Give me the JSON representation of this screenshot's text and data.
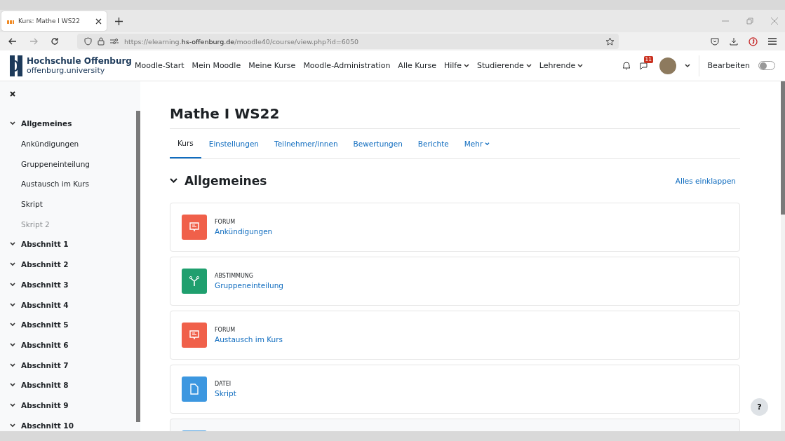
{
  "browser": {
    "tab": {
      "title": "Kurs: Mathe I WS22",
      "selected": true
    },
    "url": {
      "prefix": "https://elearning.",
      "host": "hs-offenburg.de",
      "path": "/moodle40/course/view.php?id=6050"
    }
  },
  "header": {
    "logo": {
      "name": "Hochschule Offenburg",
      "sub": "offenburg.university"
    },
    "nav": [
      {
        "label": "Moodle-Start",
        "dropdown": false
      },
      {
        "label": "Mein Moodle",
        "dropdown": false
      },
      {
        "label": "Meine Kurse",
        "dropdown": false
      },
      {
        "label": "Moodle-Administration",
        "dropdown": false
      },
      {
        "label": "Alle Kurse",
        "dropdown": false
      },
      {
        "label": "Hilfe",
        "dropdown": true
      },
      {
        "label": "Studierende",
        "dropdown": true
      },
      {
        "label": "Lehrende",
        "dropdown": true
      }
    ],
    "message_count": "11",
    "edit_mode": {
      "label": "Bearbeiten",
      "on": false
    }
  },
  "sidebar": {
    "items": [
      {
        "label": "Allgemeines",
        "children": [
          {
            "label": "Ankündigungen",
            "hidden": false
          },
          {
            "label": "Gruppeneinteilung",
            "hidden": false
          },
          {
            "label": "Austausch im Kurs",
            "hidden": false
          },
          {
            "label": "Skript",
            "hidden": false
          },
          {
            "label": "Skript 2",
            "hidden": true
          }
        ]
      },
      {
        "label": "Abschnitt 1"
      },
      {
        "label": "Abschnitt 2"
      },
      {
        "label": "Abschnitt 3"
      },
      {
        "label": "Abschnitt 4"
      },
      {
        "label": "Abschnitt 5"
      },
      {
        "label": "Abschnitt 6"
      },
      {
        "label": "Abschnitt 7"
      },
      {
        "label": "Abschnitt 8"
      },
      {
        "label": "Abschnitt 9"
      },
      {
        "label": "Abschnitt 10"
      }
    ]
  },
  "course": {
    "title": "Mathe I WS22",
    "tabs": [
      {
        "label": "Kurs",
        "selected": true,
        "dropdown": false
      },
      {
        "label": "Einstellungen",
        "selected": false,
        "dropdown": false
      },
      {
        "label": "Teilnehmer/innen",
        "selected": false,
        "dropdown": false
      },
      {
        "label": "Bewertungen",
        "selected": false,
        "dropdown": false
      },
      {
        "label": "Berichte",
        "selected": false,
        "dropdown": false
      },
      {
        "label": "Mehr",
        "selected": false,
        "dropdown": true
      }
    ],
    "section": {
      "title": "Allgemeines",
      "collapse_all": "Alles einklappen",
      "activities": [
        {
          "kind": "forum",
          "type": "FORUM",
          "name": "Ankündigungen"
        },
        {
          "kind": "choice",
          "type": "ABSTIMMUNG",
          "name": "Gruppeneinteilung"
        },
        {
          "kind": "forum",
          "type": "FORUM",
          "name": "Austausch im Kurs"
        },
        {
          "kind": "file",
          "type": "DATEI",
          "name": "Skript"
        },
        {
          "kind": "file"
        }
      ]
    }
  },
  "help_button": "?"
}
